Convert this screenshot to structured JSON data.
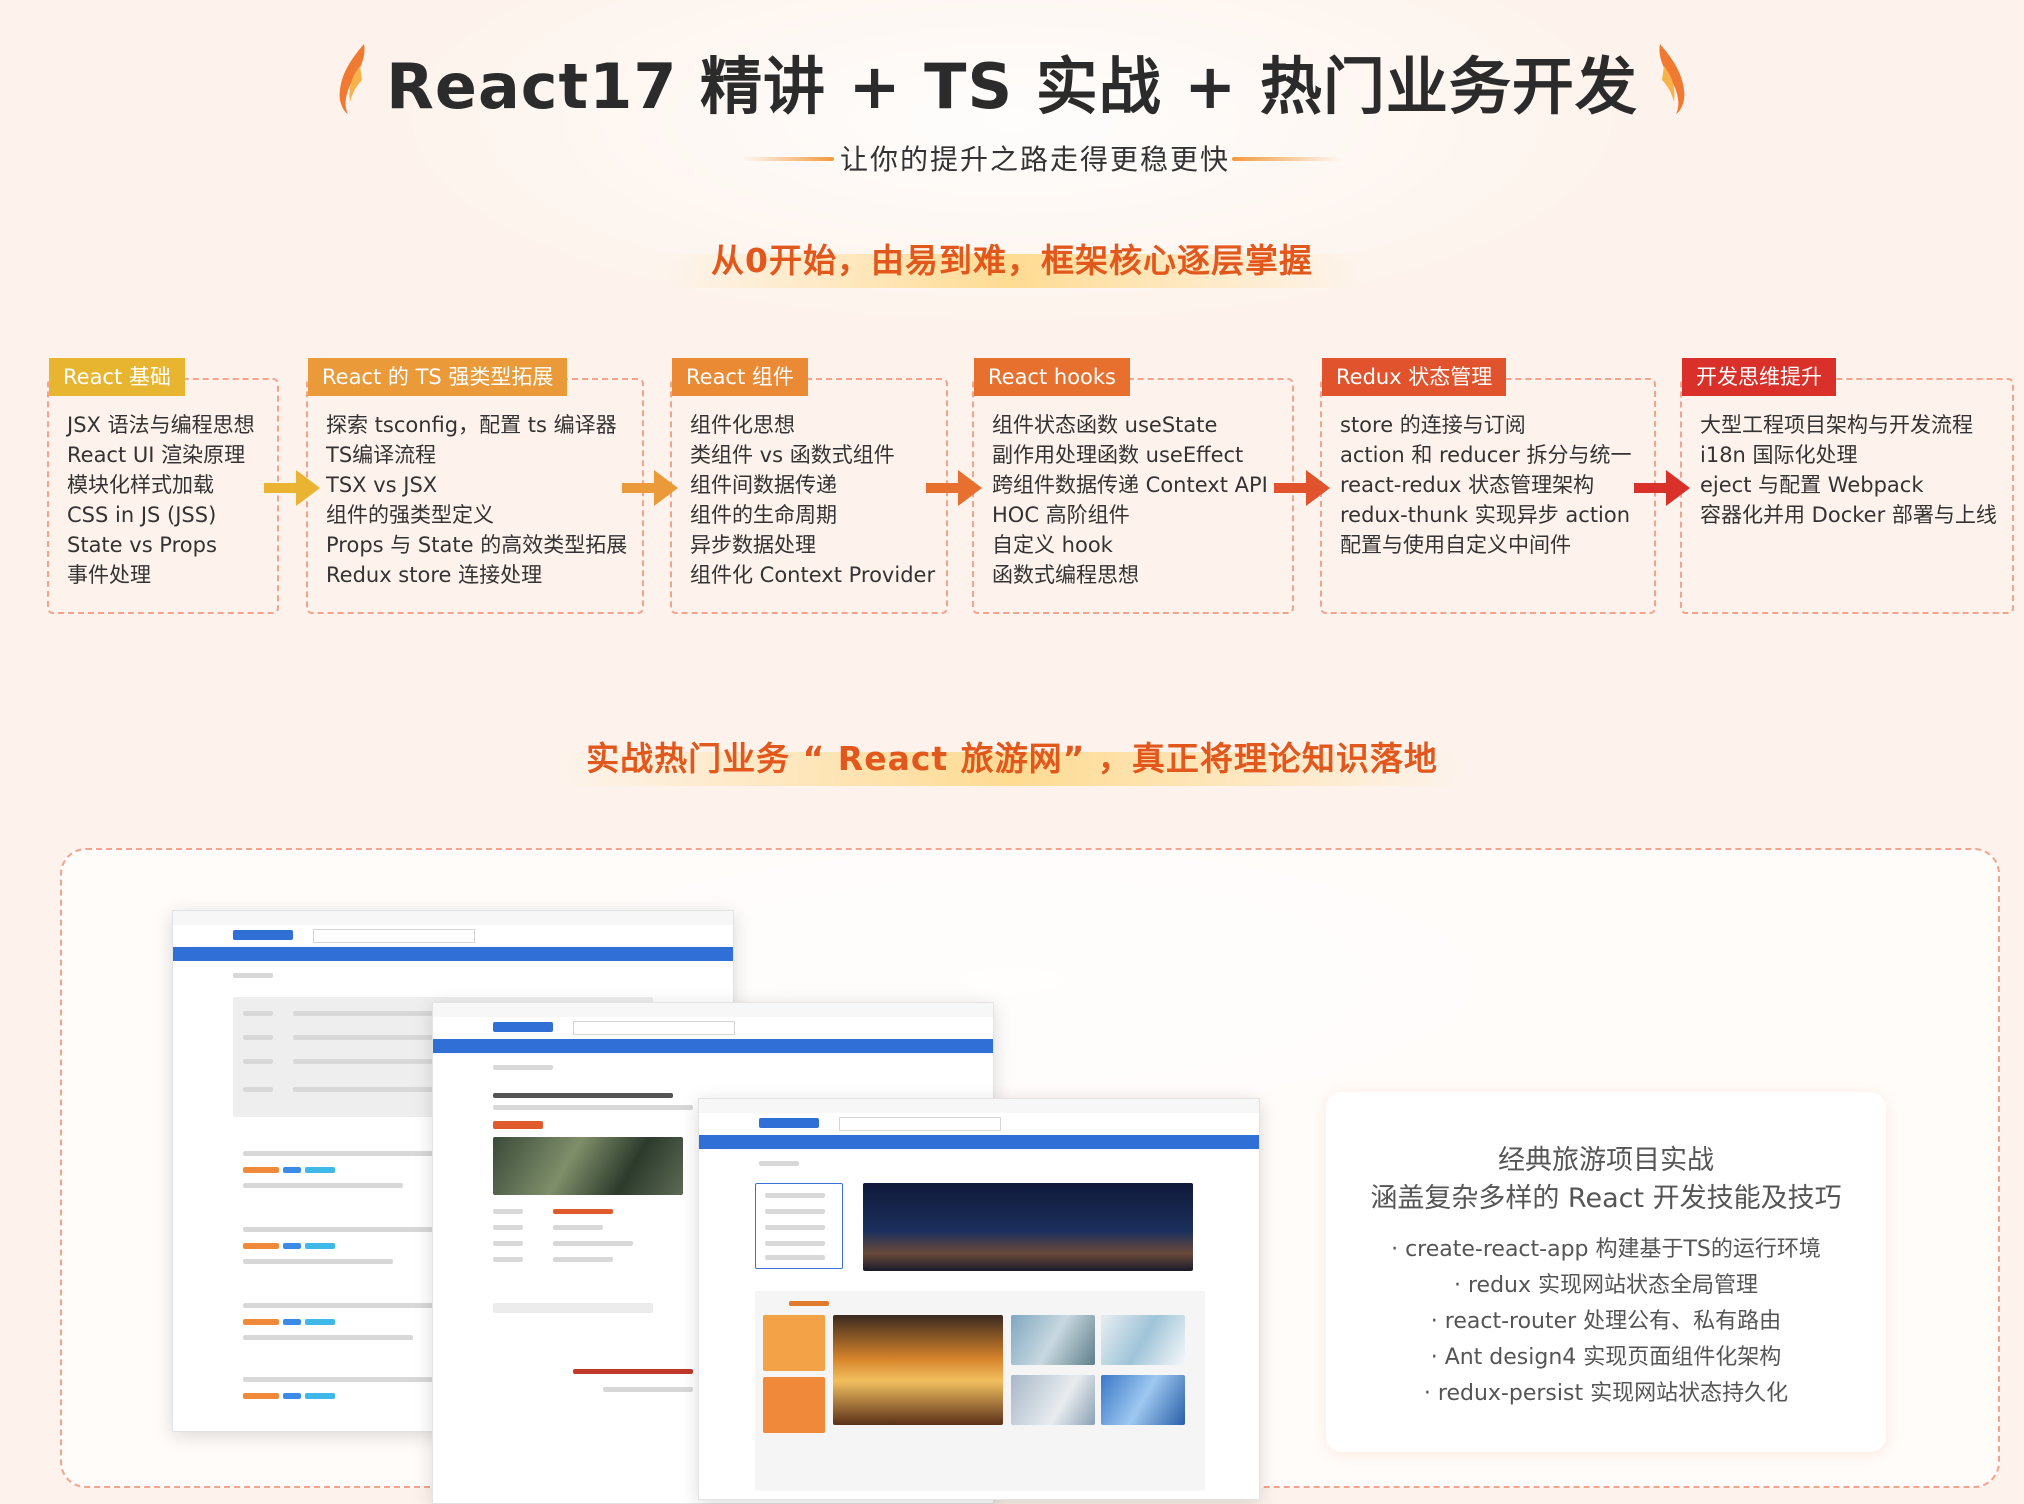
{
  "header": {
    "title": "React17 精讲 + TS 实战 + 热门业务开发",
    "subtitle": "让你的提升之路走得更稳更快"
  },
  "section1": {
    "heading": "从0开始，由易到难，框架核心逐层掌握"
  },
  "steps": [
    {
      "label": "React 基础",
      "color": "#e8b530",
      "items": [
        "JSX 语法与编程思想",
        "React UI 渲染原理",
        "模块化样式加载",
        "CSS in JS (JSS)",
        "State vs Props",
        "事件处理"
      ]
    },
    {
      "label": "React 的 TS 强类型拓展",
      "color": "#eb9a3a",
      "items": [
        "探索 tsconfig，配置 ts 编译器",
        "TS编译流程",
        "TSX vs JSX",
        "组件的强类型定义",
        "Props 与 State 的高效类型拓展",
        "Redux store 连接处理"
      ]
    },
    {
      "label": "React 组件",
      "color": "#eb8a35",
      "items": [
        "组件化思想",
        "类组件 vs 函数式组件",
        "组件间数据传递",
        "组件的生命周期",
        "异步数据处理",
        "组件化 Context Provider"
      ]
    },
    {
      "label": "React hooks",
      "color": "#e8702e",
      "items": [
        "组件状态函数 useState",
        "副作用处理函数 useEffect",
        "跨组件数据传递 Context API",
        "HOC 高阶组件",
        "自定义 hook",
        "函数式编程思想"
      ]
    },
    {
      "label": "Redux 状态管理",
      "color": "#e0532c",
      "items": [
        "store 的连接与订阅",
        "action 和 reducer 拆分与统一",
        "react-redux 状态管理架构",
        "redux-thunk 实现异步 action",
        "配置与使用自定义中间件"
      ]
    },
    {
      "label": "开发思维提升",
      "color": "#d9302a",
      "items": [
        "大型工程项目架构与开发流程",
        "i18n 国际化处理",
        "eject 与配置 Webpack",
        "容器化并用 Docker 部署与上线"
      ]
    }
  ],
  "arrows": [
    {
      "color": "#ebb332"
    },
    {
      "color": "#eb9a3a"
    },
    {
      "color": "#e8702e"
    },
    {
      "color": "#e0532c"
    },
    {
      "color": "#d9302a"
    }
  ],
  "section2": {
    "heading": "实战热门业务 “ React 旅游网” ，真正将理论知识落地"
  },
  "feature": {
    "line1": "经典旅游项目实战",
    "line2": "涵盖复杂多样的 React 开发技能及技巧",
    "items": [
      "· create-react-app 构建基于TS的运行环境",
      "· redux 实现网站状态全局管理",
      "· react-router 处理公有、私有路由",
      "· Ant design4 实现页面组件化架构",
      "· redux-persist 实现网站状态持久化"
    ]
  },
  "screens": [
    {
      "name": "search-results-page"
    },
    {
      "name": "product-detail-page"
    },
    {
      "name": "home-page"
    }
  ]
}
